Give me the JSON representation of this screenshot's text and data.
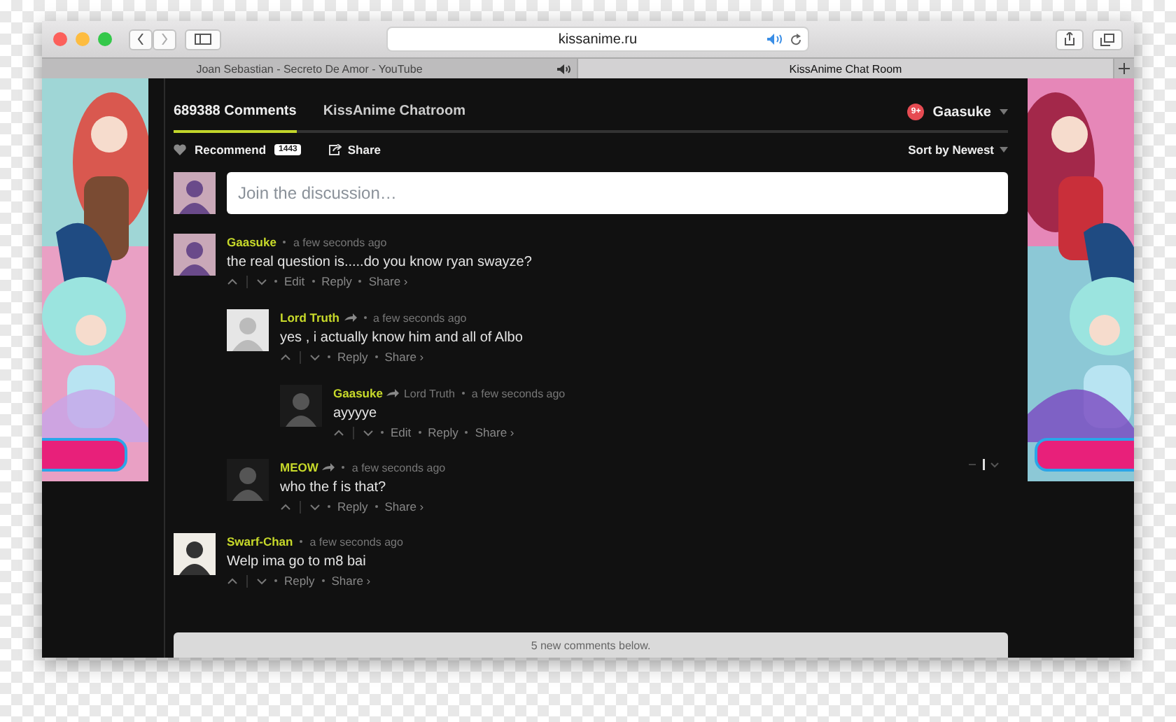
{
  "browser": {
    "address": "kissanime.ru",
    "tabs": [
      {
        "title": "Joan Sebastian - Secreto De Amor - YouTube",
        "playing_audio": true,
        "selected": false
      },
      {
        "title": "KissAnime Chat Room",
        "playing_audio": false,
        "selected": true
      }
    ]
  },
  "header": {
    "tabs": [
      {
        "label": "689388 Comments",
        "selected": true
      },
      {
        "label": "KissAnime Chatroom",
        "selected": false
      }
    ],
    "user": {
      "name": "Gaasuke",
      "badge": "9+"
    }
  },
  "actions": {
    "recommend": "Recommend",
    "recommend_count": "1443",
    "share": "Share",
    "sort": "Sort by Newest"
  },
  "composer": {
    "placeholder": "Join the discussion…"
  },
  "comments": [
    {
      "author": "Gaasuke",
      "time": "a few seconds ago",
      "text": "the real question is.....do you know ryan swayze?",
      "actions": [
        "Edit",
        "Reply",
        "Share ›"
      ],
      "children": [
        {
          "author": "Lord Truth",
          "reply_arrow": true,
          "time": "a few seconds ago",
          "text": "yes , i actually know him and all of Albo",
          "actions": [
            "Reply",
            "Share ›"
          ],
          "children": [
            {
              "author": "Gaasuke",
              "reply_arrow": true,
              "reply_to": "Lord Truth",
              "time": "a few seconds ago",
              "text": "ayyyye",
              "actions": [
                "Edit",
                "Reply",
                "Share ›"
              ]
            }
          ]
        },
        {
          "author": "MEOW",
          "reply_arrow": true,
          "time": "a few seconds ago",
          "text": "who the f is that?",
          "actions": [
            "Reply",
            "Share ›"
          ],
          "menu": true
        }
      ]
    },
    {
      "author": "Swarf-Chan",
      "time": "a few seconds ago",
      "text": "Welp ima go to m8 bai",
      "actions": [
        "Reply",
        "Share ›"
      ]
    }
  ],
  "new_comments_bar": "5 new comments below."
}
